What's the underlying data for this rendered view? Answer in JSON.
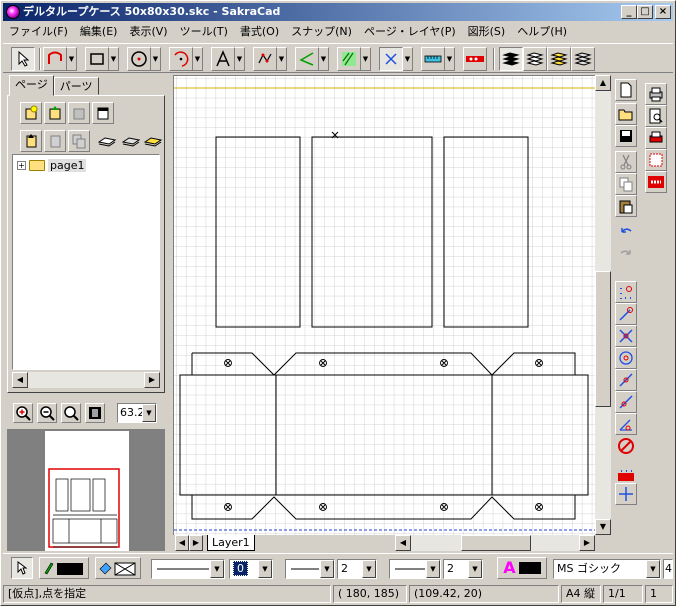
{
  "window": {
    "title": "デルタループケース 50x80x30.skc - SakraCad",
    "min": "_",
    "max": "□",
    "close": "×"
  },
  "menu": [
    "ファイル(F)",
    "編集(E)",
    "表示(V)",
    "ツール(T)",
    "書式(O)",
    "スナップ(N)",
    "ページ・レイヤ(P)",
    "図形(S)",
    "ヘルプ(H)"
  ],
  "panel": {
    "tabs": [
      "ページ",
      "パーツ"
    ],
    "tree": {
      "expander": "+",
      "item": "page1"
    },
    "zoom_value": "63.26"
  },
  "canvas": {
    "layer_tab": "Layer1"
  },
  "props": {
    "color_value": "0",
    "line_width": "2",
    "line_width2": "2",
    "text_icon": "A",
    "font": "MS ゴシック",
    "font_size": "4"
  },
  "status": {
    "hint": "[仮点],点を指定",
    "coords": "(    180,     185)",
    "real_coords": "(109.42,     20)",
    "paper": "A4 縦",
    "page": "1/1",
    "layer": "1"
  },
  "colors": {
    "accent": "#0a246a",
    "grid": "#c8c8c8",
    "guide": "#d0b000",
    "preview_frame": "#e00000"
  }
}
